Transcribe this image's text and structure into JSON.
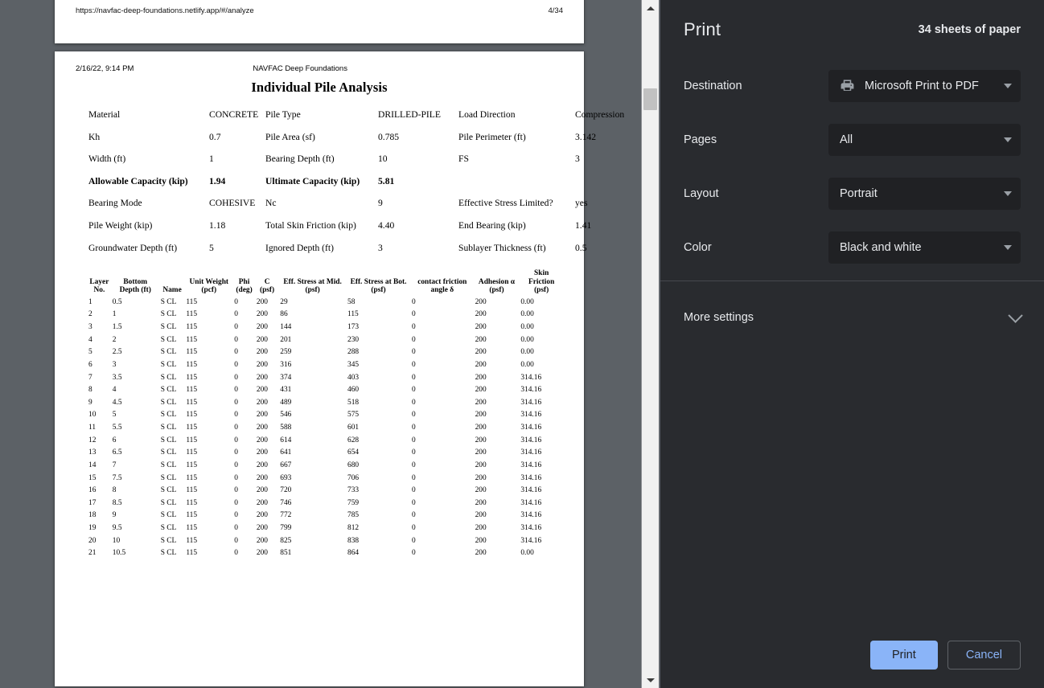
{
  "preview": {
    "page_prev": {
      "url": "https://navfac-deep-foundations.netlify.app/#/analyze",
      "page_number": "4/34"
    },
    "document": {
      "timestamp": "2/16/22, 9:14 PM",
      "site_title": "NAVFAC Deep Foundations",
      "title": "Individual Pile Analysis",
      "param_rows": [
        {
          "bold": false,
          "l1": "Material",
          "v1": "CONCRETE",
          "l2": "Pile Type",
          "v2": "DRILLED-PILE",
          "l3": "Load Direction",
          "v3": "Compression"
        },
        {
          "bold": false,
          "l1": "Kh",
          "v1": "0.7",
          "l2": "Pile Area (sf)",
          "v2": "0.785",
          "l3": "Pile Perimeter (ft)",
          "v3": "3.142"
        },
        {
          "bold": false,
          "l1": "Width (ft)",
          "v1": "1",
          "l2": "Bearing Depth (ft)",
          "v2": "10",
          "l3": "FS",
          "v3": "3"
        },
        {
          "bold": true,
          "l1": "Allowable Capacity (kip)",
          "v1": "1.94",
          "l2": "Ultimate Capacity (kip)",
          "v2": "5.81",
          "l3": "",
          "v3": ""
        },
        {
          "bold": false,
          "l1": "Bearing Mode",
          "v1": "COHESIVE",
          "l2": "Nc",
          "v2": "9",
          "l3": "Effective Stress Limited?",
          "v3": "yes"
        },
        {
          "bold": false,
          "l1": "Pile Weight (kip)",
          "v1": "1.18",
          "l2": "Total Skin Friction (kip)",
          "v2": "4.40",
          "l3": "End Bearing (kip)",
          "v3": "1.41"
        },
        {
          "bold": false,
          "l1": "Groundwater Depth (ft)",
          "v1": "5",
          "l2": "Ignored Depth (ft)",
          "v2": "3",
          "l3": "Sublayer Thickness (ft)",
          "v3": "0.5"
        }
      ],
      "table": {
        "headers": [
          "Layer No.",
          "Bottom Depth (ft)",
          "Name",
          "Unit Weight (pcf)",
          "Phi (deg)",
          "C (psf)",
          "Eff. Stress at Mid. (psf)",
          "Eff. Stress at Bot. (psf)",
          "contact friction angle δ",
          "Adhesion α (psf)",
          "Skin Friction (psf)"
        ],
        "headers_lines": [
          [
            "Layer",
            "No."
          ],
          [
            "Bottom",
            "Depth (ft)"
          ],
          [
            "Name",
            ""
          ],
          [
            "Unit Weight",
            "(pcf)"
          ],
          [
            "Phi",
            "(deg)"
          ],
          [
            "C",
            "(psf)"
          ],
          [
            "Eff. Stress at Mid.",
            "(psf)"
          ],
          [
            "Eff. Stress at Bot.",
            "(psf)"
          ],
          [
            "contact friction",
            "angle δ"
          ],
          [
            "Adhesion α",
            "(psf)"
          ],
          [
            "Skin Friction",
            "(psf)"
          ]
        ],
        "rows": [
          [
            "1",
            "0.5",
            "S CL",
            "115",
            "0",
            "200",
            "29",
            "58",
            "0",
            "200",
            "0.00"
          ],
          [
            "2",
            "1",
            "S CL",
            "115",
            "0",
            "200",
            "86",
            "115",
            "0",
            "200",
            "0.00"
          ],
          [
            "3",
            "1.5",
            "S CL",
            "115",
            "0",
            "200",
            "144",
            "173",
            "0",
            "200",
            "0.00"
          ],
          [
            "4",
            "2",
            "S CL",
            "115",
            "0",
            "200",
            "201",
            "230",
            "0",
            "200",
            "0.00"
          ],
          [
            "5",
            "2.5",
            "S CL",
            "115",
            "0",
            "200",
            "259",
            "288",
            "0",
            "200",
            "0.00"
          ],
          [
            "6",
            "3",
            "S CL",
            "115",
            "0",
            "200",
            "316",
            "345",
            "0",
            "200",
            "0.00"
          ],
          [
            "7",
            "3.5",
            "S CL",
            "115",
            "0",
            "200",
            "374",
            "403",
            "0",
            "200",
            "314.16"
          ],
          [
            "8",
            "4",
            "S CL",
            "115",
            "0",
            "200",
            "431",
            "460",
            "0",
            "200",
            "314.16"
          ],
          [
            "9",
            "4.5",
            "S CL",
            "115",
            "0",
            "200",
            "489",
            "518",
            "0",
            "200",
            "314.16"
          ],
          [
            "10",
            "5",
            "S CL",
            "115",
            "0",
            "200",
            "546",
            "575",
            "0",
            "200",
            "314.16"
          ],
          [
            "11",
            "5.5",
            "S CL",
            "115",
            "0",
            "200",
            "588",
            "601",
            "0",
            "200",
            "314.16"
          ],
          [
            "12",
            "6",
            "S CL",
            "115",
            "0",
            "200",
            "614",
            "628",
            "0",
            "200",
            "314.16"
          ],
          [
            "13",
            "6.5",
            "S CL",
            "115",
            "0",
            "200",
            "641",
            "654",
            "0",
            "200",
            "314.16"
          ],
          [
            "14",
            "7",
            "S CL",
            "115",
            "0",
            "200",
            "667",
            "680",
            "0",
            "200",
            "314.16"
          ],
          [
            "15",
            "7.5",
            "S CL",
            "115",
            "0",
            "200",
            "693",
            "706",
            "0",
            "200",
            "314.16"
          ],
          [
            "16",
            "8",
            "S CL",
            "115",
            "0",
            "200",
            "720",
            "733",
            "0",
            "200",
            "314.16"
          ],
          [
            "17",
            "8.5",
            "S CL",
            "115",
            "0",
            "200",
            "746",
            "759",
            "0",
            "200",
            "314.16"
          ],
          [
            "18",
            "9",
            "S CL",
            "115",
            "0",
            "200",
            "772",
            "785",
            "0",
            "200",
            "314.16"
          ],
          [
            "19",
            "9.5",
            "S CL",
            "115",
            "0",
            "200",
            "799",
            "812",
            "0",
            "200",
            "314.16"
          ],
          [
            "20",
            "10",
            "S CL",
            "115",
            "0",
            "200",
            "825",
            "838",
            "0",
            "200",
            "314.16"
          ],
          [
            "21",
            "10.5",
            "S CL",
            "115",
            "0",
            "200",
            "851",
            "864",
            "0",
            "200",
            "0.00"
          ]
        ]
      }
    }
  },
  "print_dialog": {
    "title": "Print",
    "sheet_count": "34 sheets of paper",
    "settings": [
      {
        "label": "Destination",
        "value": "Microsoft Print to PDF",
        "icon": "printer-icon"
      },
      {
        "label": "Pages",
        "value": "All",
        "icon": ""
      },
      {
        "label": "Layout",
        "value": "Portrait",
        "icon": ""
      },
      {
        "label": "Color",
        "value": "Black and white",
        "icon": ""
      }
    ],
    "more_settings_label": "More settings",
    "print_button": "Print",
    "cancel_button": "Cancel",
    "colors": {
      "panel_bg": "#292b2f",
      "select_bg": "#202124",
      "accent": "#8ab4f8",
      "text": "#e8eaed",
      "muted": "#9aa0a6"
    }
  }
}
